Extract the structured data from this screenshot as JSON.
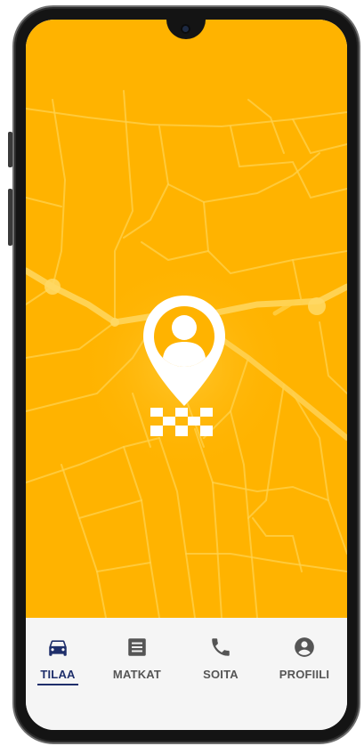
{
  "colors": {
    "map_background": "#ffb300",
    "accent_active": "#1f2f6b",
    "tab_inactive": "#555555",
    "tabbar_background": "#f5f5f5"
  },
  "map": {
    "pin_icon": "person-location-pin-icon",
    "taxi_icon": "taxi-checker-icon"
  },
  "tabs": [
    {
      "label": "TILAA",
      "icon": "car-icon",
      "active": true
    },
    {
      "label": "MATKAT",
      "icon": "list-icon",
      "active": false
    },
    {
      "label": "SOITA",
      "icon": "phone-icon",
      "active": false
    },
    {
      "label": "PROFIILI",
      "icon": "account-circle-icon",
      "active": false
    }
  ]
}
